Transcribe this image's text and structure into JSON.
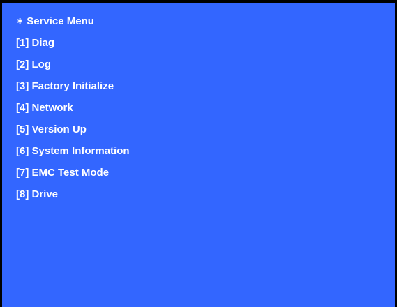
{
  "colors": {
    "background": "#3366ff",
    "text": "#ffffff",
    "border": "#000000"
  },
  "menu": {
    "title_marker": "✱",
    "title": "Service Menu",
    "items": [
      {
        "label": "[1] Diag"
      },
      {
        "label": "[2] Log"
      },
      {
        "label": "[3] Factory Initialize"
      },
      {
        "label": "[4] Network"
      },
      {
        "label": "[5] Version Up"
      },
      {
        "label": "[6] System Information"
      },
      {
        "label": "[7] EMC Test Mode"
      },
      {
        "label": "[8] Drive"
      }
    ]
  }
}
